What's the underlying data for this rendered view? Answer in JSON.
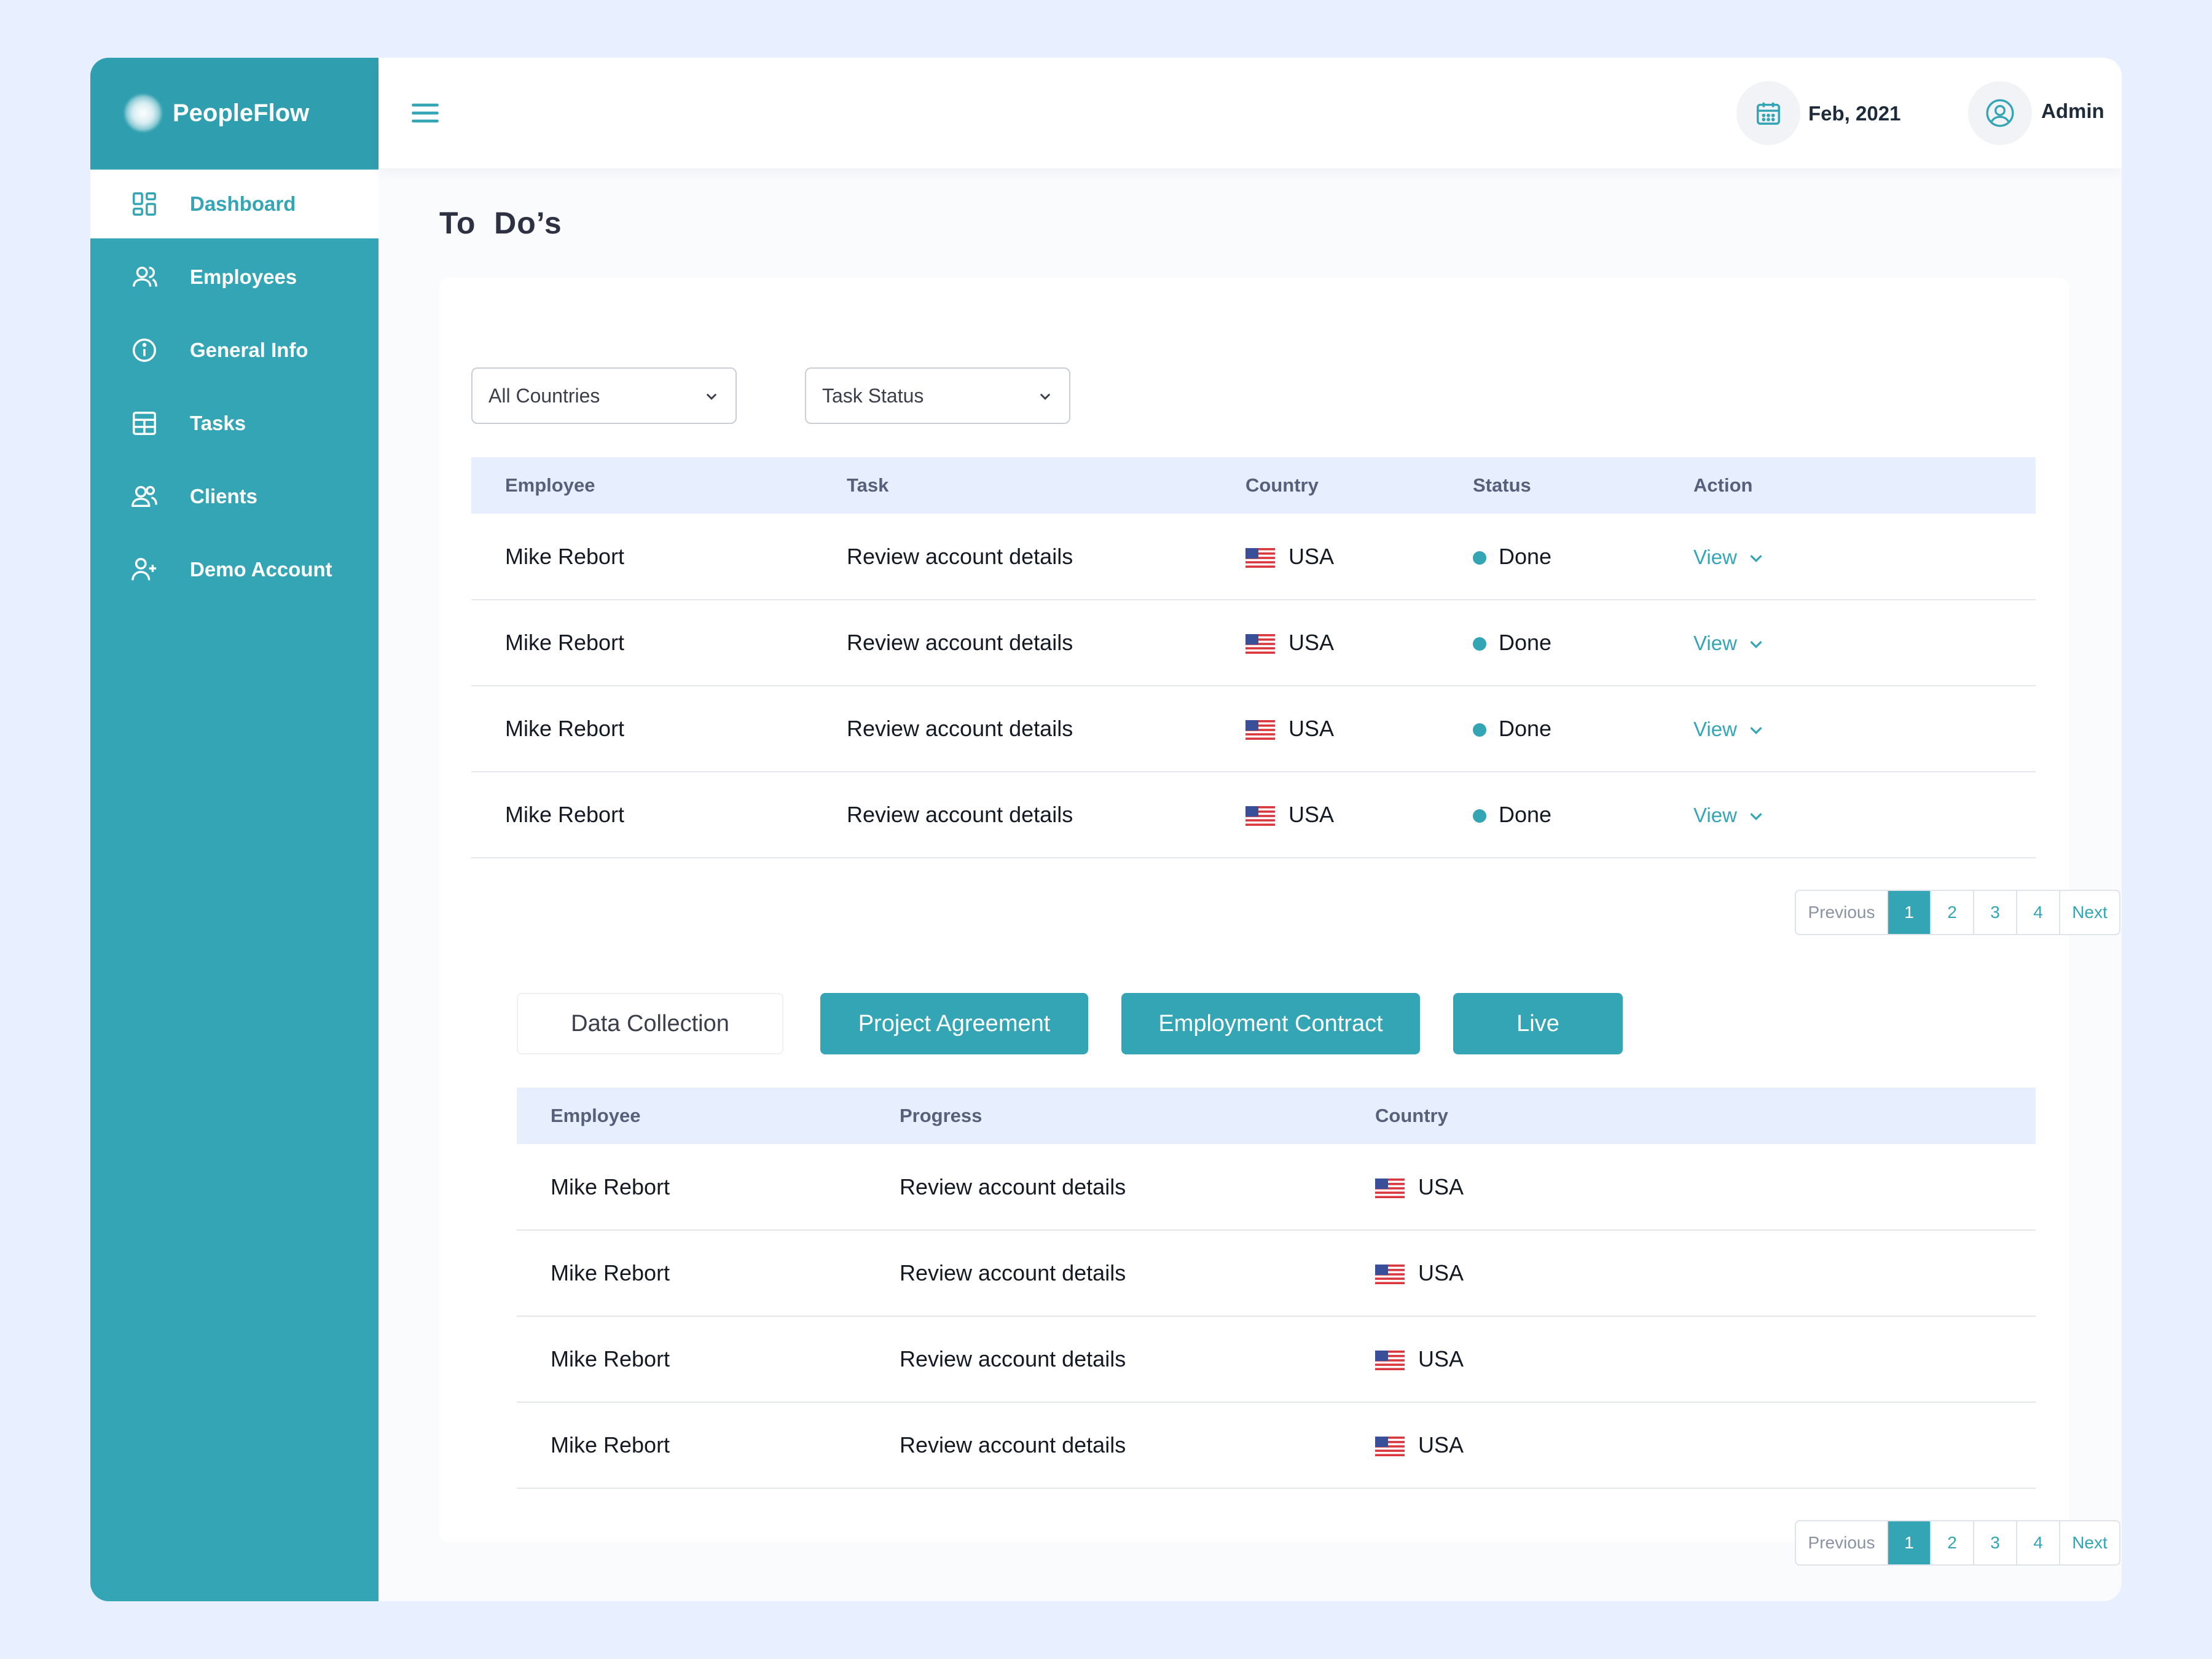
{
  "app": {
    "name": "PeopleFlow"
  },
  "sidebar": {
    "items": [
      {
        "label": "Dashboard",
        "icon": "dashboard-icon",
        "active": true
      },
      {
        "label": "Employees",
        "icon": "users-icon",
        "active": false
      },
      {
        "label": "General Info",
        "icon": "info-icon",
        "active": false
      },
      {
        "label": "Tasks",
        "icon": "tasks-icon",
        "active": false
      },
      {
        "label": "Clients",
        "icon": "clients-icon",
        "active": false
      },
      {
        "label": "Demo Account",
        "icon": "add-user-icon",
        "active": false
      }
    ]
  },
  "topbar": {
    "date": "Feb, 2021",
    "user": "Admin"
  },
  "page": {
    "title": "To  Do’s"
  },
  "filters": {
    "country": "All Countries",
    "status": "Task Status"
  },
  "todo_table": {
    "columns": [
      "Employee",
      "Task",
      "Country",
      "Status",
      "Action"
    ],
    "rows": [
      {
        "employee": "Mike Rebort",
        "task": "Review account details",
        "country": "USA",
        "status": "Done",
        "action": "View"
      },
      {
        "employee": "Mike Rebort",
        "task": "Review account details",
        "country": "USA",
        "status": "Done",
        "action": "View"
      },
      {
        "employee": "Mike Rebort",
        "task": "Review account details",
        "country": "USA",
        "status": "Done",
        "action": "View"
      },
      {
        "employee": "Mike Rebort",
        "task": "Review account details",
        "country": "USA",
        "status": "Done",
        "action": "View"
      }
    ]
  },
  "pagination": {
    "previous": "Previous",
    "pages": [
      "1",
      "2",
      "3",
      "4"
    ],
    "next": "Next",
    "current": "1"
  },
  "tabs": [
    {
      "label": "Data Collection",
      "active": false
    },
    {
      "label": "Project Agreement",
      "active": true
    },
    {
      "label": "Employment Contract",
      "active": true
    },
    {
      "label": "Live",
      "active": true
    }
  ],
  "progress_table": {
    "columns": [
      "Employee",
      "Progress",
      "Country"
    ],
    "rows": [
      {
        "employee": "Mike Rebort",
        "progress": "Review account details",
        "country": "USA"
      },
      {
        "employee": "Mike Rebort",
        "progress": "Review account details",
        "country": "USA"
      },
      {
        "employee": "Mike Rebort",
        "progress": "Review account details",
        "country": "USA"
      },
      {
        "employee": "Mike Rebort",
        "progress": "Review account details",
        "country": "USA"
      }
    ]
  },
  "colors": {
    "accent": "#34a5b4",
    "header_bg": "#e7efff",
    "page_bg": "#e8efff"
  }
}
